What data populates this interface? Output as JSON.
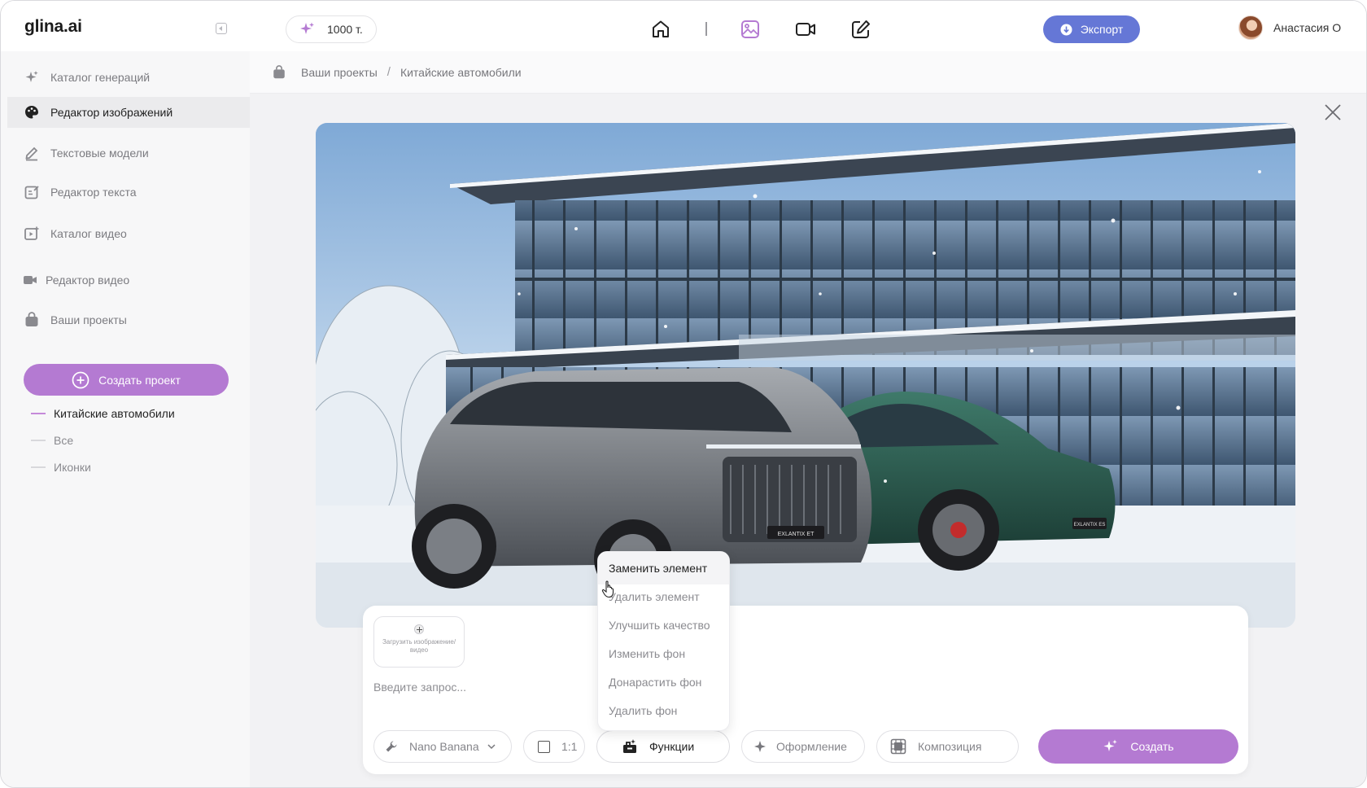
{
  "app": {
    "logo": "glina.ai"
  },
  "topbar": {
    "credits": "1000 т.",
    "nav_icons": [
      "home-icon",
      "image-icon",
      "video-icon",
      "edit-icon"
    ],
    "active_nav": "image-icon",
    "export_label": "Экспорт",
    "user_name": "Анастасия О"
  },
  "sidebar": {
    "items": [
      {
        "label": "Каталог генераций",
        "icon": "sparkles-icon"
      },
      {
        "label": "Редактор изображений",
        "icon": "palette-icon",
        "active": true
      },
      {
        "label": "Текстовые модели",
        "icon": "pen-line-icon"
      },
      {
        "label": "Редактор текста",
        "icon": "edit-box-icon"
      },
      {
        "label": "Каталог видео",
        "icon": "video-add-icon"
      },
      {
        "label": "Редактор видео",
        "icon": "camera-icon"
      },
      {
        "label": "Ваши проекты",
        "icon": "bag-icon"
      }
    ],
    "create_project_label": "Создать проект",
    "projects": [
      {
        "label": "Китайские автомобили",
        "active": true
      },
      {
        "label": "Все"
      },
      {
        "label": "Иконки"
      }
    ]
  },
  "breadcrumb": {
    "items": [
      "Ваши проекты",
      "Китайские автомобили"
    ],
    "separator": "/"
  },
  "canvas": {
    "car_left_badge": "EXLANTIX ET",
    "car_right_badge": "EXLANTIX ES"
  },
  "composer": {
    "upload_label": "Загрузить изображение/видео",
    "prompt_placeholder": "Введите запрос...",
    "model_label": "Nano Banana",
    "ratio_label": "1:1",
    "functions_label": "Функции",
    "style_label": "Оформление",
    "composition_label": "Композиция",
    "create_label": "Создать"
  },
  "functions_menu": {
    "items": [
      "Заменить элемент",
      "Удалить элемент",
      "Улучшить качество",
      "Изменить фон",
      "Донарастить фон",
      "Удалить фон"
    ],
    "hovered": 0
  },
  "colors": {
    "accent_purple": "#b47ad2",
    "export_blue": "#6577d6",
    "sidebar_bg": "#f7f7f8",
    "main_bg": "#f2f2f4"
  }
}
